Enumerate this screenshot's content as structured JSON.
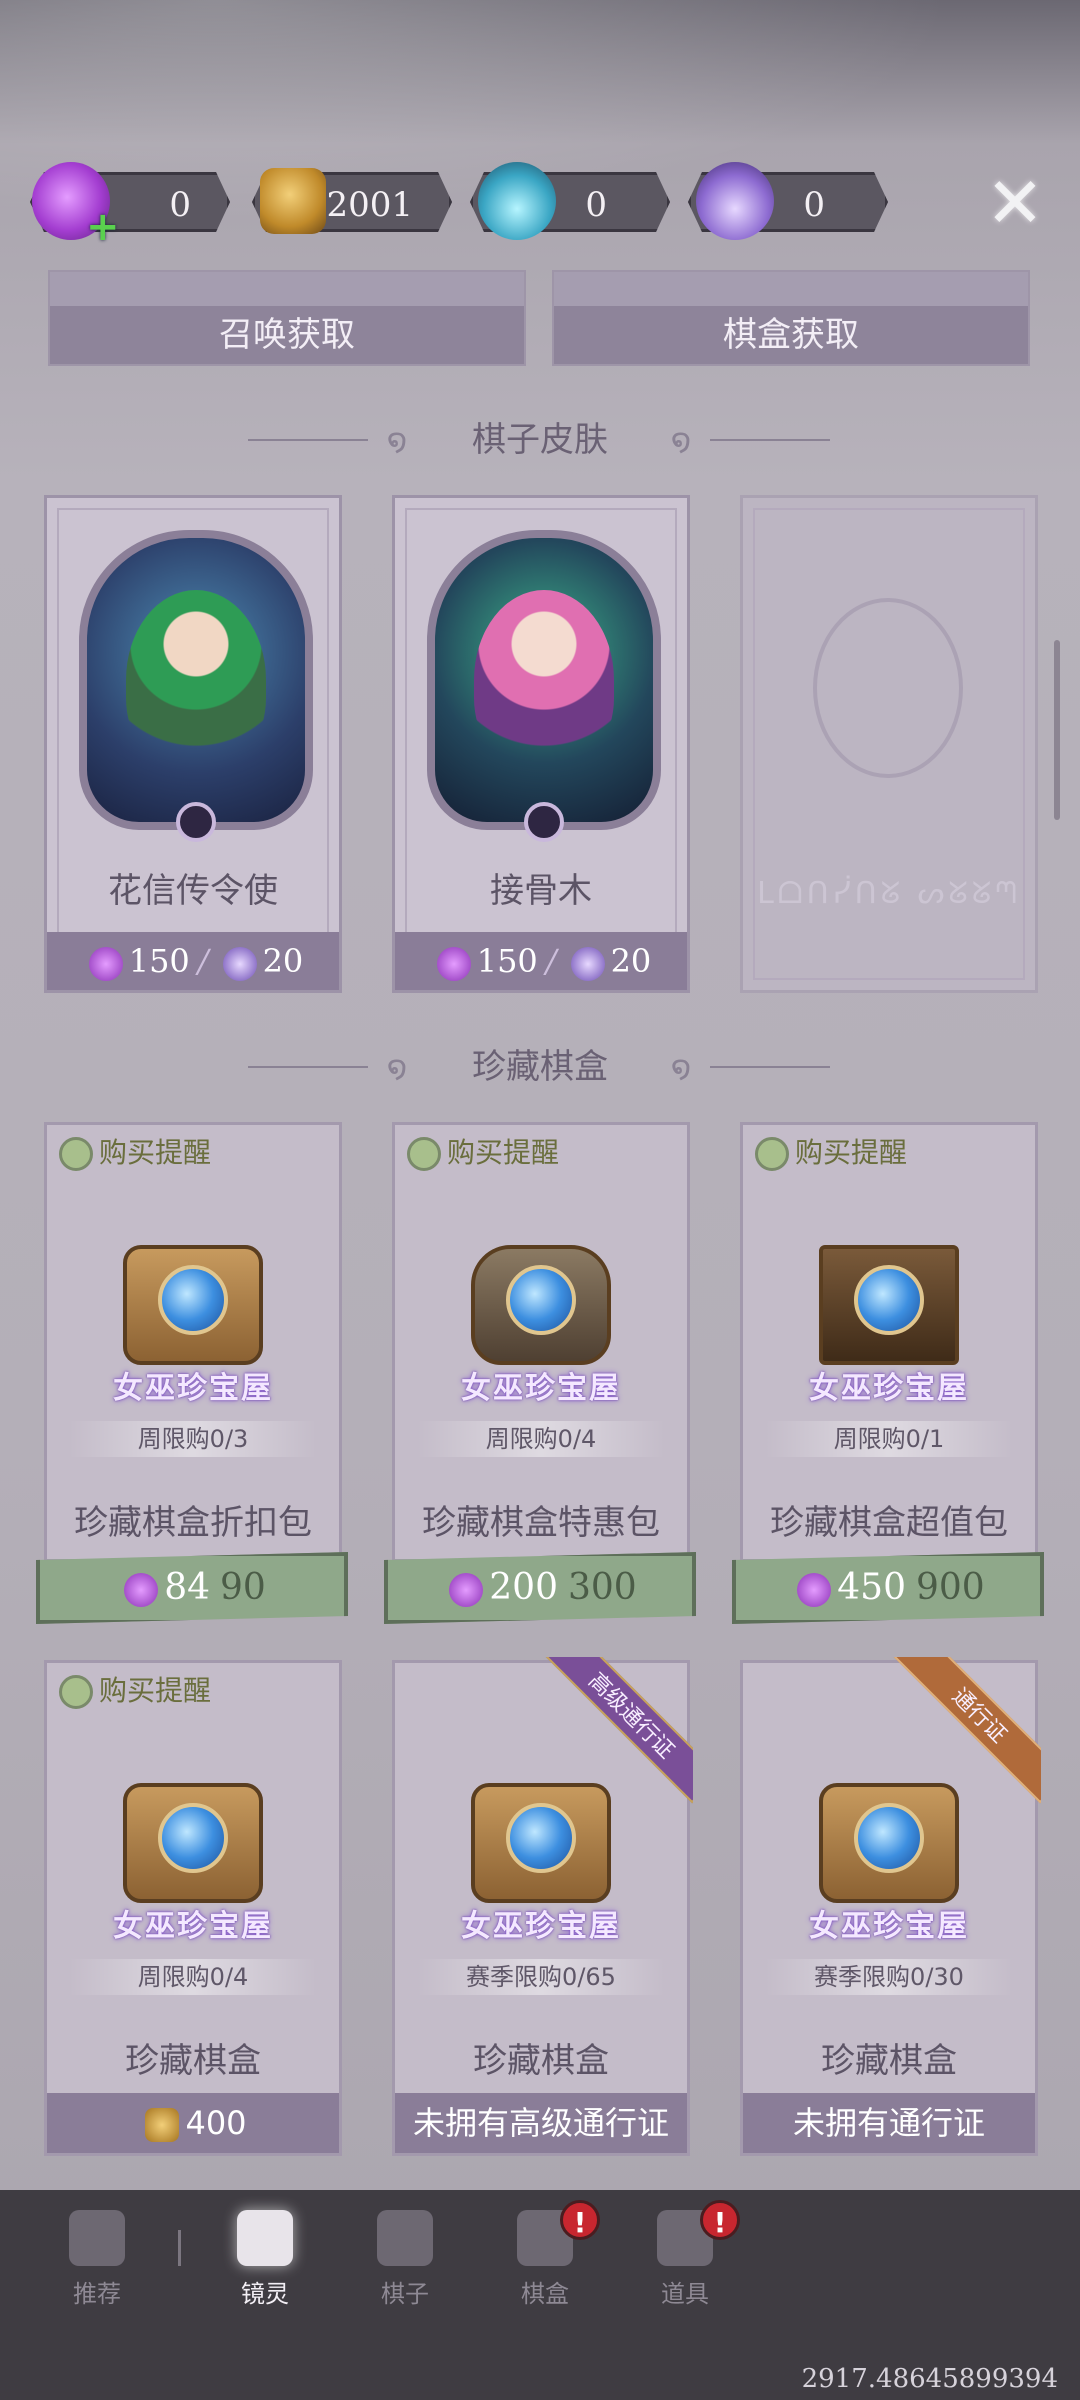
{
  "currencies": [
    {
      "icon": "candy-icon",
      "value": "0"
    },
    {
      "icon": "pumpkin-coin-icon",
      "value": "2001"
    },
    {
      "icon": "blue-potion-icon",
      "value": "0"
    },
    {
      "icon": "purple-potion-icon",
      "value": "0"
    }
  ],
  "acquire": {
    "left_label": "召唤获取",
    "right_label": "棋盒获取"
  },
  "sections": {
    "skins_title": "棋子皮肤",
    "boxes_title": "珍藏棋盒"
  },
  "skins": [
    {
      "name": "花信传令使",
      "candy_cost": "150",
      "potion_cost": "20"
    },
    {
      "name": "接骨木",
      "candy_cost": "150",
      "potion_cost": "20"
    }
  ],
  "boxes": [
    {
      "remind": "购买提醒",
      "brand": "女巫珍宝屋",
      "limit": "周限购0/3",
      "name": "珍藏棋盒折扣包",
      "price": "84",
      "old_price": "90"
    },
    {
      "remind": "购买提醒",
      "brand": "女巫珍宝屋",
      "limit": "周限购0/4",
      "name": "珍藏棋盒特惠包",
      "price": "200",
      "old_price": "300"
    },
    {
      "remind": "购买提醒",
      "brand": "女巫珍宝屋",
      "limit": "周限购0/1",
      "name": "珍藏棋盒超值包",
      "price": "450",
      "old_price": "900"
    },
    {
      "remind": "购买提醒",
      "brand": "女巫珍宝屋",
      "limit": "周限购0/4",
      "name": "珍藏棋盒",
      "price": "400"
    },
    {
      "ribbon": "高级通行证",
      "brand": "女巫珍宝屋",
      "limit": "赛季限购0/65",
      "name": "珍藏棋盒",
      "foot": "未拥有高级通行证"
    },
    {
      "ribbon": "通行证",
      "brand": "女巫珍宝屋",
      "limit": "赛季限购0/30",
      "name": "珍藏棋盒",
      "foot": "未拥有通行证"
    }
  ],
  "nav": [
    {
      "label": "推荐",
      "icon": "recommend-icon"
    },
    {
      "label": "镜灵",
      "icon": "mirror-spirit-icon",
      "active": true
    },
    {
      "label": "棋子",
      "icon": "chess-piece-icon"
    },
    {
      "label": "棋盒",
      "icon": "chess-box-icon",
      "badge": "!"
    },
    {
      "label": "道具",
      "icon": "props-icon",
      "badge": "!"
    }
  ],
  "coord_readout": "2917.48645899394",
  "colors": {
    "accent": "#8a7d98",
    "price_bar": "#8fa88a",
    "badge": "#c8262f"
  }
}
